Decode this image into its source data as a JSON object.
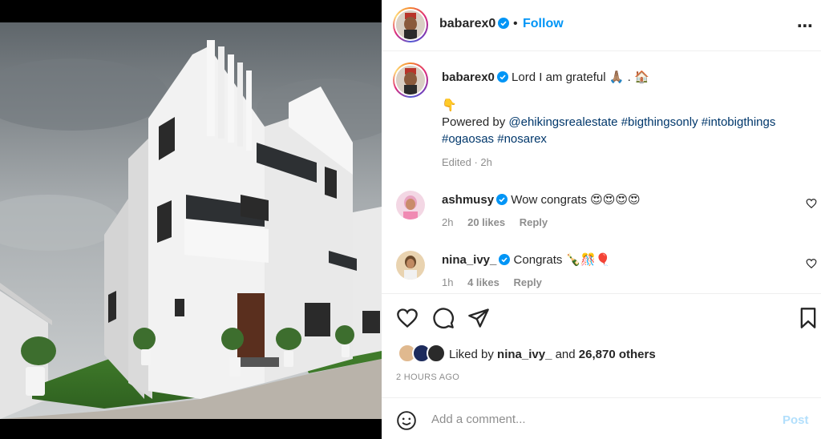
{
  "post": {
    "username": "babarex0",
    "follow_label": "Follow",
    "dot": "•",
    "more_icon": "⋯"
  },
  "caption": {
    "username": "babarex0",
    "text": "Lord I am grateful 🙏🏽 . 🏠",
    "pointer": "👇",
    "powered_by": "Powered by",
    "mention": "@ehikingsrealestate",
    "hashtags_line1": "#bigthingsonly #intobigthings",
    "hashtags_line2": "#ogaosas #nosarex",
    "edited": "Edited · 2h"
  },
  "comments": [
    {
      "username": "ashmusy",
      "text": "Wow congrats 😍😍😍😍",
      "time": "2h",
      "likes": "20 likes",
      "reply": "Reply"
    },
    {
      "username": "nina_ivy_",
      "text": "Congrats 🍾🎊🎈",
      "time": "1h",
      "likes": "4 likes",
      "reply": "Reply"
    }
  ],
  "likes": {
    "prefix": "Liked by",
    "user": "nina_ivy_",
    "and": "and",
    "others": "26,870 others"
  },
  "timestamp": "2 HOURS AGO",
  "add_comment": {
    "placeholder": "Add a comment...",
    "post_label": "Post"
  },
  "colors": {
    "accent": "#0095f6",
    "post_disabled": "#b2dffc",
    "hashtag": "#00376b",
    "muted": "#8e8e8e"
  },
  "icons": [
    "heart-icon",
    "comment-icon",
    "share-icon",
    "bookmark-icon",
    "emoji-icon",
    "verified-icon",
    "more-icon"
  ]
}
